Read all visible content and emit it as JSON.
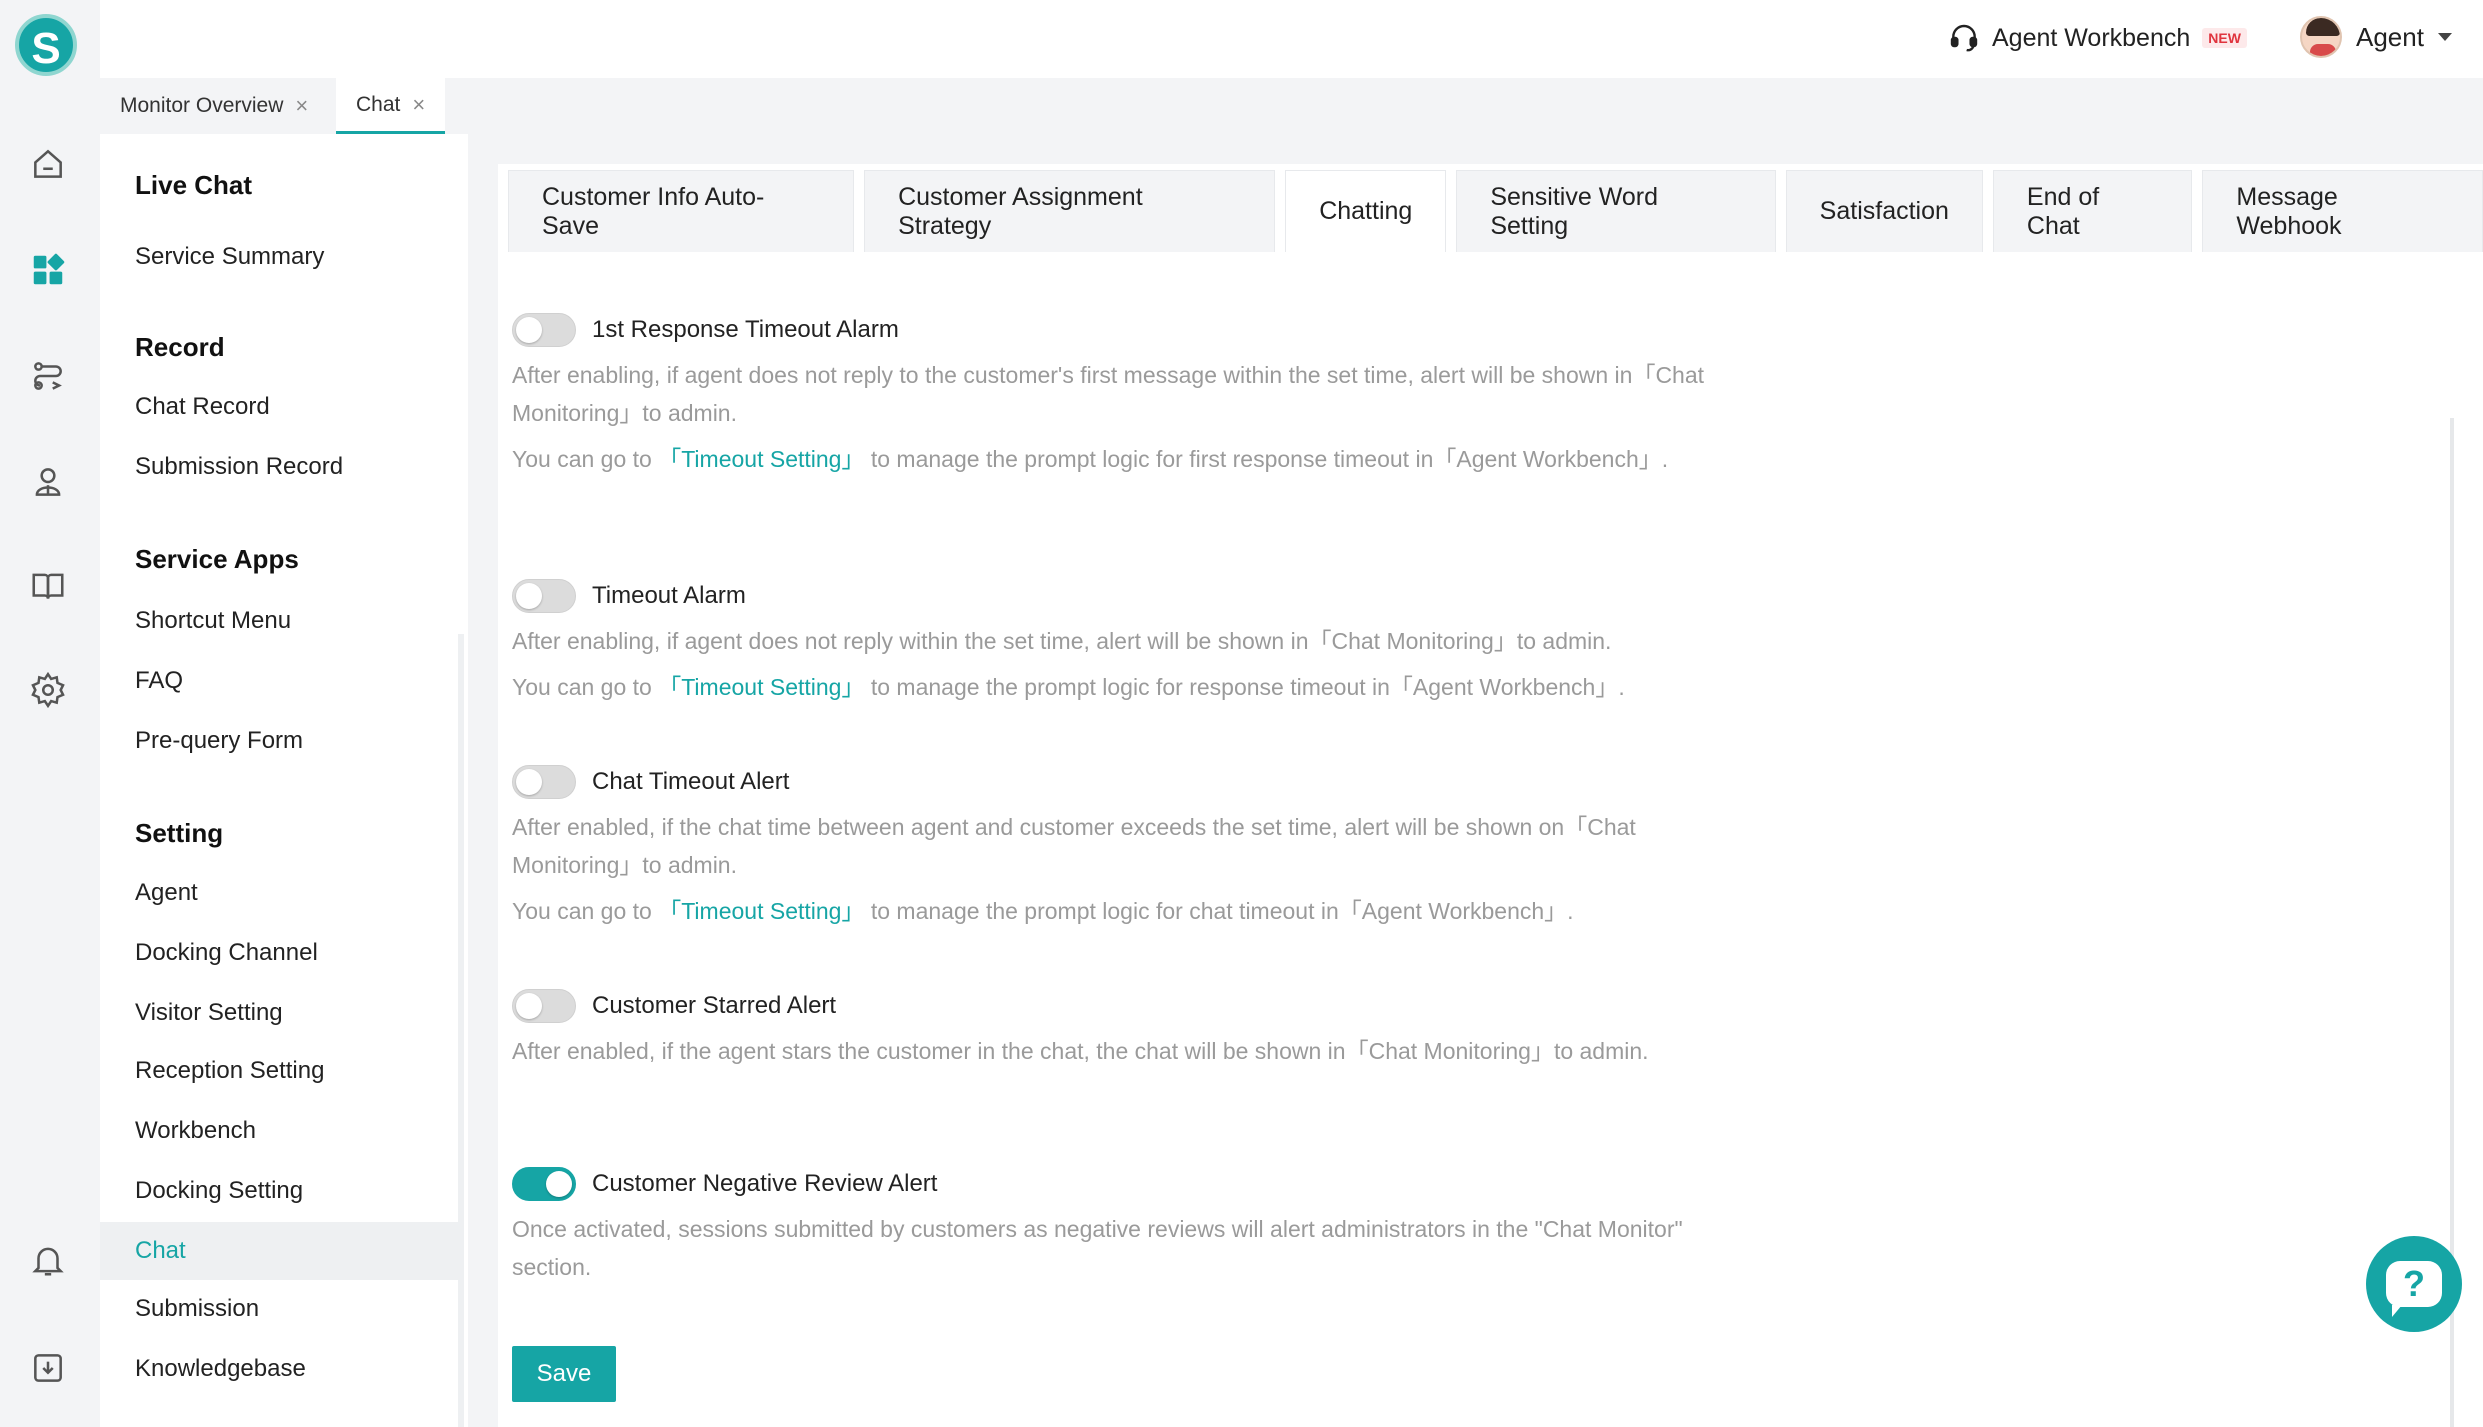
{
  "brand": {
    "logo_letter": "S",
    "accent": "#16a5a5"
  },
  "rail_icons": [
    "home-icon",
    "grid-icon",
    "route-icon",
    "user-icon",
    "book-icon",
    "gear-icon",
    "bell-icon",
    "download-icon"
  ],
  "topbar": {
    "workbench_label": "Agent Workbench",
    "new_badge": "NEW",
    "user_label": "Agent"
  },
  "page_tabs": [
    {
      "label": "Monitor Overview",
      "close": "×"
    },
    {
      "label": "Chat",
      "close": "×"
    }
  ],
  "subnav": {
    "groups": {
      "live_chat": "Live Chat",
      "record": "Record",
      "service_apps": "Service Apps",
      "setting": "Setting"
    },
    "items": {
      "service_summary": "Service Summary",
      "chat_record": "Chat Record",
      "submission_record": "Submission Record",
      "shortcut_menu": "Shortcut Menu",
      "faq": "FAQ",
      "pre_query_form": "Pre-query Form",
      "agent": "Agent",
      "docking_channel": "Docking Channel",
      "visitor_setting": "Visitor Setting",
      "reception_setting": "Reception Setting",
      "workbench": "Workbench",
      "docking_setting": "Docking Setting",
      "chat": "Chat",
      "submission": "Submission",
      "knowledgebase": "Knowledgebase"
    }
  },
  "setting_tabs": [
    "Customer Info Auto-Save",
    "Customer Assignment Strategy",
    "Chatting",
    "Sensitive Word Setting",
    "Satisfaction",
    "End of Chat",
    "Message Webhook"
  ],
  "settings": {
    "first_response": {
      "label": "1st Response Timeout Alarm",
      "enabled": false,
      "desc": "After enabling, if agent does not reply to the customer's first message within the set time, alert will be shown in「Chat Monitoring」to admin.",
      "hint_pre": "You can go to ",
      "hint_link": "「Timeout Setting」",
      "hint_post": " to manage the prompt logic for first response timeout in「Agent Workbench」."
    },
    "timeout": {
      "label": "Timeout Alarm",
      "enabled": false,
      "desc": "After enabling, if agent does not reply within the set time, alert will be shown in「Chat Monitoring」to admin.",
      "hint_pre": "You can go to ",
      "hint_link": "「Timeout Setting」",
      "hint_post": " to manage the prompt logic for response timeout in「Agent Workbench」."
    },
    "chat_timeout": {
      "label": "Chat Timeout Alert",
      "enabled": false,
      "desc": "After enabled, if the chat time between agent and customer exceeds the set time, alert will be shown on「Chat Monitoring」to admin.",
      "hint_pre": "You can go to ",
      "hint_link": "「Timeout Setting」",
      "hint_post": " to manage the prompt logic for chat timeout in「Agent Workbench」."
    },
    "starred": {
      "label": "Customer Starred Alert",
      "enabled": false,
      "desc": "After enabled, if the agent stars the customer in the chat, the chat will be shown in「Chat Monitoring」to admin."
    },
    "negative_review": {
      "label": "Customer Negative Review Alert",
      "enabled": true,
      "desc": "Once activated, sessions submitted by customers as negative reviews will alert administrators in the \"Chat Monitor\" section."
    }
  },
  "save_label": "Save",
  "help_symbol": "?"
}
